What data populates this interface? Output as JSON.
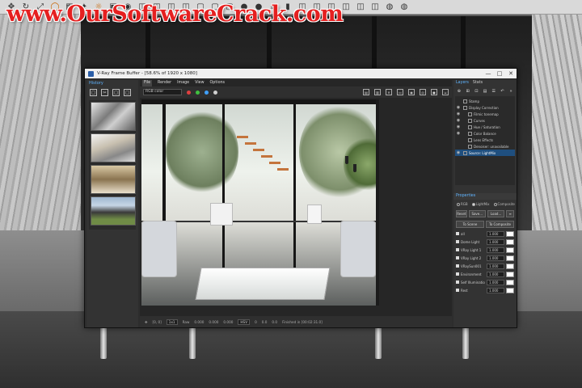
{
  "watermark": "www.OurSoftwareCrack.com",
  "top_toolbar": {
    "icons": [
      "move-icon",
      "rotate-icon",
      "scale-icon",
      "circle-icon",
      "grid-icon",
      "light-icon",
      "sun-icon",
      "camera-icon",
      "render-icon",
      "cube-icon",
      "cube-icon",
      "cube-icon",
      "cube-icon",
      "box-icon",
      "box-icon",
      "box-icon",
      "sphere-icon",
      "sphere-icon",
      "teapot-icon",
      "cylinder-icon",
      "cube-icon",
      "cube-icon",
      "cube-icon",
      "cube-icon",
      "cube-icon",
      "cube-icon",
      "globe-icon",
      "globe-icon"
    ]
  },
  "window": {
    "title": "V-Ray Frame Buffer - [58.6% of 1920 x 1080]",
    "minimize": "—",
    "maximize": "□",
    "close": "✕"
  },
  "history": {
    "label": "History",
    "tools": [
      "□",
      "✂",
      "□",
      "□"
    ]
  },
  "menu": {
    "file": "File",
    "render": "Render",
    "image": "Image",
    "view": "View",
    "options": "Options"
  },
  "viewbar": {
    "channel": "RGB color",
    "dot_colors": [
      "#e04040",
      "#40c040",
      "#40a0ff",
      "#d0d0d0"
    ]
  },
  "statusbar": {
    "coords": "[0, 0]",
    "zoom": "1x1",
    "mode": "Raw",
    "vals": [
      "0.000",
      "0.000",
      "0.000"
    ],
    "space": "HSV",
    "extra": [
      "0",
      "0.0",
      "0.0"
    ],
    "finished": "Finished in [00:02:31.0]"
  },
  "right_panel": {
    "tab_layers": "Layers",
    "tab_stats": "Stats",
    "tools": [
      "⊕",
      "⊞",
      "⊡",
      "▤",
      "☰",
      "↶",
      "»"
    ],
    "layers": [
      {
        "label": "Stamp",
        "eye": false
      },
      {
        "label": "Display Correction",
        "eye": true
      },
      {
        "label": "Filmic tonemap",
        "eye": true
      },
      {
        "label": "Curves",
        "eye": true
      },
      {
        "label": "Hue / Saturation",
        "eye": true
      },
      {
        "label": "Color Balance",
        "eye": true
      },
      {
        "label": "Lens Effects",
        "eye": false
      },
      {
        "label": "Denoiser: unavailable",
        "eye": false
      },
      {
        "label": "Source: LightMix",
        "eye": true
      }
    ],
    "properties": "Properties",
    "radio": [
      "RGB",
      "LightMix",
      "Composite"
    ],
    "buttons": [
      "Reset",
      "Save...",
      "Load...",
      "≡"
    ],
    "to_scene": "To Scene",
    "to_composite": "To Composite",
    "channels": [
      {
        "name": "all",
        "value": "1.000"
      },
      {
        "name": "Dome Light",
        "value": "1.000"
      },
      {
        "name": "VRay Light 1",
        "value": "1.000"
      },
      {
        "name": "VRay Light 2",
        "value": "1.000"
      },
      {
        "name": "VRaySun001",
        "value": "1.000"
      },
      {
        "name": "Environment",
        "value": "1.000"
      },
      {
        "name": "Self Illumination",
        "value": "1.000"
      },
      {
        "name": "Rest",
        "value": "1.000"
      }
    ]
  }
}
